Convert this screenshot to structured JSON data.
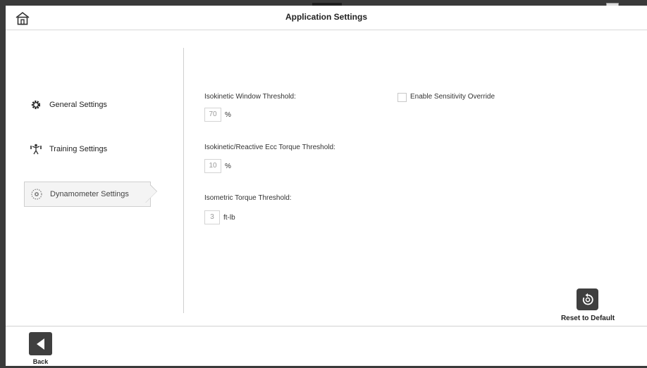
{
  "header": {
    "title": "Application Settings",
    "home_icon": "home-icon"
  },
  "sidebar": {
    "items": [
      {
        "label": "General Settings",
        "icon": "gear-icon",
        "active": false
      },
      {
        "label": "Training Settings",
        "icon": "exercise-figure-icon",
        "active": false
      },
      {
        "label": "Dynamometer Settings",
        "icon": "dynamometer-icon",
        "active": true
      }
    ]
  },
  "settings": {
    "isokinetic_window": {
      "label": "Isokinetic Window Threshold:",
      "value": "70",
      "unit": "%"
    },
    "reactive_ecc": {
      "label": "Isokinetic/Reactive Ecc Torque Threshold:",
      "value": "10",
      "unit": "%"
    },
    "isometric": {
      "label": "Isometric Torque Threshold:",
      "value": "3",
      "unit": "ft-lb"
    },
    "sensitivity_override": {
      "label": "Enable Sensitivity Override",
      "checked": false
    }
  },
  "actions": {
    "reset_label": "Reset to Default",
    "back_label": "Back"
  },
  "colors": {
    "button_bg": "#3f3f3f",
    "active_item_bg": "#f4f4f4",
    "divider": "#cfcfcf"
  }
}
